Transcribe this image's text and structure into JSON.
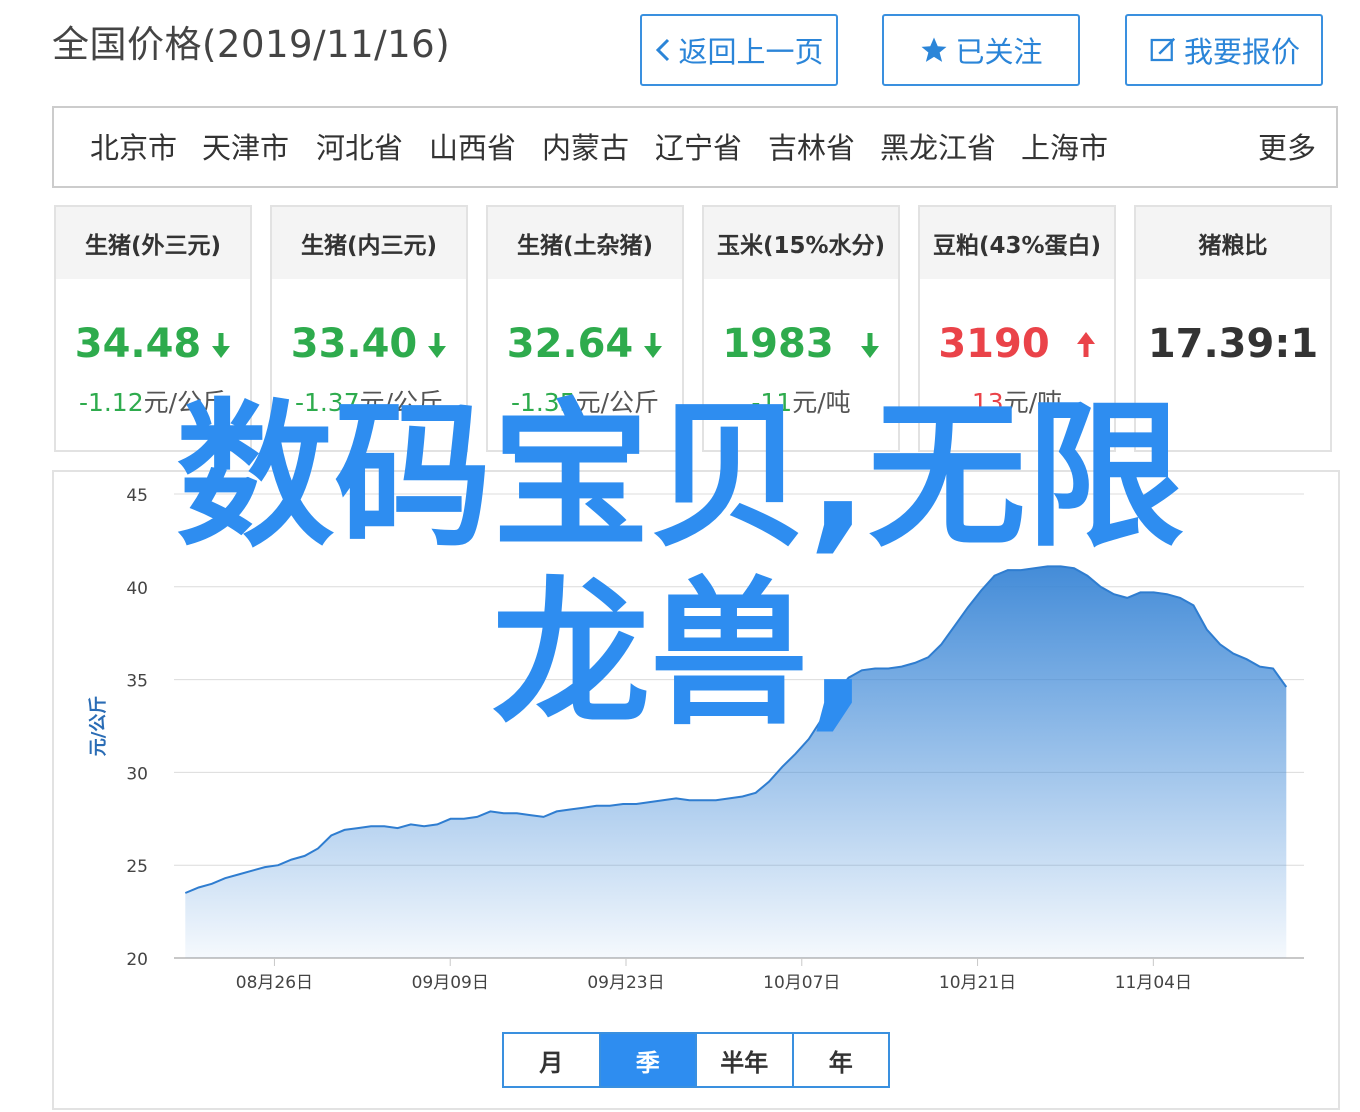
{
  "header": {
    "title": "全国价格(2019/11/16)",
    "buttons": {
      "back": "返回上一页",
      "follow": "已关注",
      "quote": "我要报价"
    }
  },
  "regions": {
    "items": [
      "北京市",
      "天津市",
      "河北省",
      "山西省",
      "内蒙古",
      "辽宁省",
      "吉林省",
      "黑龙江省",
      "上海市"
    ],
    "more": "更多"
  },
  "cards": [
    {
      "name": "生猪(外三元)",
      "price": "34.48",
      "direction": "down",
      "change": "-1.12",
      "unit": "元/公斤"
    },
    {
      "name": "生猪(内三元)",
      "price": "33.40",
      "direction": "down",
      "change": "-1.37",
      "unit": "元/公斤"
    },
    {
      "name": "生猪(土杂猪)",
      "price": "32.64",
      "direction": "down",
      "change": "-1.35",
      "unit": "元/公斤"
    },
    {
      "name": "玉米(15%水分)",
      "price": "1983",
      "direction": "down",
      "change": "-11",
      "unit": "元/吨"
    },
    {
      "name": "豆粕(43%蛋白)",
      "price": "3190",
      "direction": "up",
      "change": "13",
      "unit": "元/吨"
    },
    {
      "name": "猪粮比",
      "price": "17.39:1",
      "direction": "none",
      "change": "",
      "unit": ""
    }
  ],
  "colors": {
    "accent": "#2e8df0",
    "down": "#2eab4d",
    "up": "#ea4349"
  },
  "overlay": {
    "line1": "数码宝贝,无限",
    "line2": "龙兽,"
  },
  "period": {
    "options": [
      "月",
      "季",
      "半年",
      "年"
    ],
    "active": "季"
  },
  "chart_data": {
    "type": "area",
    "ylabel": "元/公斤",
    "ylim": [
      20,
      45
    ],
    "yticks": [
      20,
      25,
      30,
      35,
      40,
      45
    ],
    "x_tick_labels": [
      "08月26日",
      "09月09日",
      "09月23日",
      "10月07日",
      "10月21日",
      "11月04日"
    ],
    "x_start": "2019-08-18",
    "x_end": "2019-11-16",
    "grid": true,
    "series": [
      {
        "values": [
          23.5,
          23.8,
          24.0,
          24.3,
          24.5,
          24.7,
          24.9,
          25.0,
          25.3,
          25.5,
          25.9,
          26.6,
          26.9,
          27.0,
          27.1,
          27.1,
          27.0,
          27.2,
          27.1,
          27.2,
          27.5,
          27.5,
          27.6,
          27.9,
          27.8,
          27.8,
          27.7,
          27.6,
          27.9,
          28.0,
          28.1,
          28.2,
          28.2,
          28.3,
          28.3,
          28.4,
          28.5,
          28.6,
          28.5,
          28.5,
          28.5,
          28.6,
          28.7,
          28.9,
          29.5,
          30.3,
          31.0,
          31.8,
          32.9,
          34.2,
          35.1,
          35.5,
          35.6,
          35.6,
          35.7,
          35.9,
          36.2,
          36.9,
          37.9,
          38.9,
          39.8,
          40.6,
          40.9,
          40.9,
          41.0,
          41.1,
          41.1,
          41.0,
          40.6,
          40.0,
          39.6,
          39.4,
          39.7,
          39.7,
          39.6,
          39.4,
          39.0,
          37.7,
          36.9,
          36.4,
          36.1,
          35.7,
          35.6,
          34.6
        ]
      }
    ]
  }
}
